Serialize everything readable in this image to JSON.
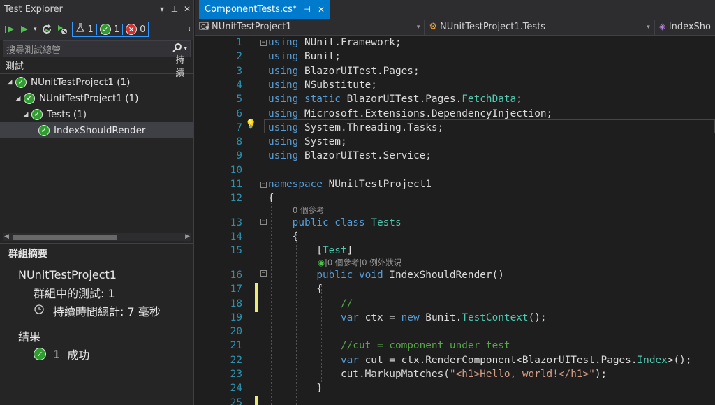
{
  "test_explorer": {
    "title": "Test Explorer",
    "pin": "▾ ⊥",
    "close": "✕",
    "counters": {
      "flask": "1",
      "passed": "1",
      "failed": "0"
    },
    "search_placeholder": "搜尋測試總管",
    "col_test": "測試",
    "col_duration": "持續",
    "tree": [
      {
        "label": "NUnitTestProject1 (1)"
      },
      {
        "label": "NUnitTestProject1 (1)"
      },
      {
        "label": "Tests (1)"
      },
      {
        "label": "IndexShouldRender"
      }
    ],
    "summary": {
      "header": "群組摘要",
      "project": "NUnitTestProject1",
      "tests_in_group": "群組中的測試: 1",
      "duration": "持續時間總計: 7 毫秒",
      "results_header": "結果",
      "result_count": "1",
      "result_text": "成功"
    }
  },
  "editor": {
    "tab_title": "ComponentTests.cs*",
    "nav_project": "NUnitTestProject1",
    "nav_class": "NUnitTestProject1.Tests",
    "nav_member": "IndexSho",
    "refs_class": "0 個參考",
    "refs_method": "|0 個參考|0 例外狀況",
    "lines": [
      "1",
      "2",
      "3",
      "4",
      "5",
      "6",
      "7",
      "8",
      "9",
      "10",
      "11",
      "12",
      "13",
      "14",
      "15",
      "16",
      "17",
      "18",
      "19",
      "20",
      "21",
      "22",
      "23",
      "24",
      "25"
    ]
  }
}
